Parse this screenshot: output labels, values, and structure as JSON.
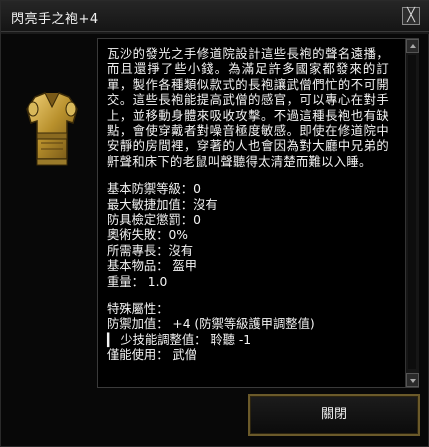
{
  "window": {
    "title": "閃亮手之袍+4",
    "close_label": "╳"
  },
  "item": {
    "icon": "golden-robe-icon",
    "description": "瓦沙的發光之手修道院設計這些長袍的聲名遠播，而且還掙了些小錢。為滿足許多國家都發來的訂單，製作各種類似款式的長袍讓武僧們忙的不可開交。這些長袍能提高武僧的感官，可以專心在對手上，並移動身體來吸收攻擊。不過這種長袍也有缺點，會使穿戴者對噪音極度敏感。即使在修道院中安靜的房間裡，穿著的人也會因為對大廳中兄弟的鼾聲和床下的老鼠叫聲聽得太清楚而難以入睡。",
    "stats": [
      "基本防禦等級：0",
      "最大敏捷加值：沒有",
      "防具檢定懲罰：0",
      "奧術失敗：0%",
      "所需專長：沒有",
      "基本物品： 盔甲",
      "重量： 1.0"
    ],
    "properties_title": "特殊屬性：",
    "properties": [
      "防禦加值： +4 (防禦等級護甲調整值)",
      "▎ 少技能調整值： 聆聽 -1",
      "僅能使用： 武僧"
    ]
  },
  "buttons": {
    "close": "關閉"
  },
  "colors": {
    "background": "#080808",
    "button_border": "#6b5a2a",
    "robe_gold": "#c9a23a"
  }
}
